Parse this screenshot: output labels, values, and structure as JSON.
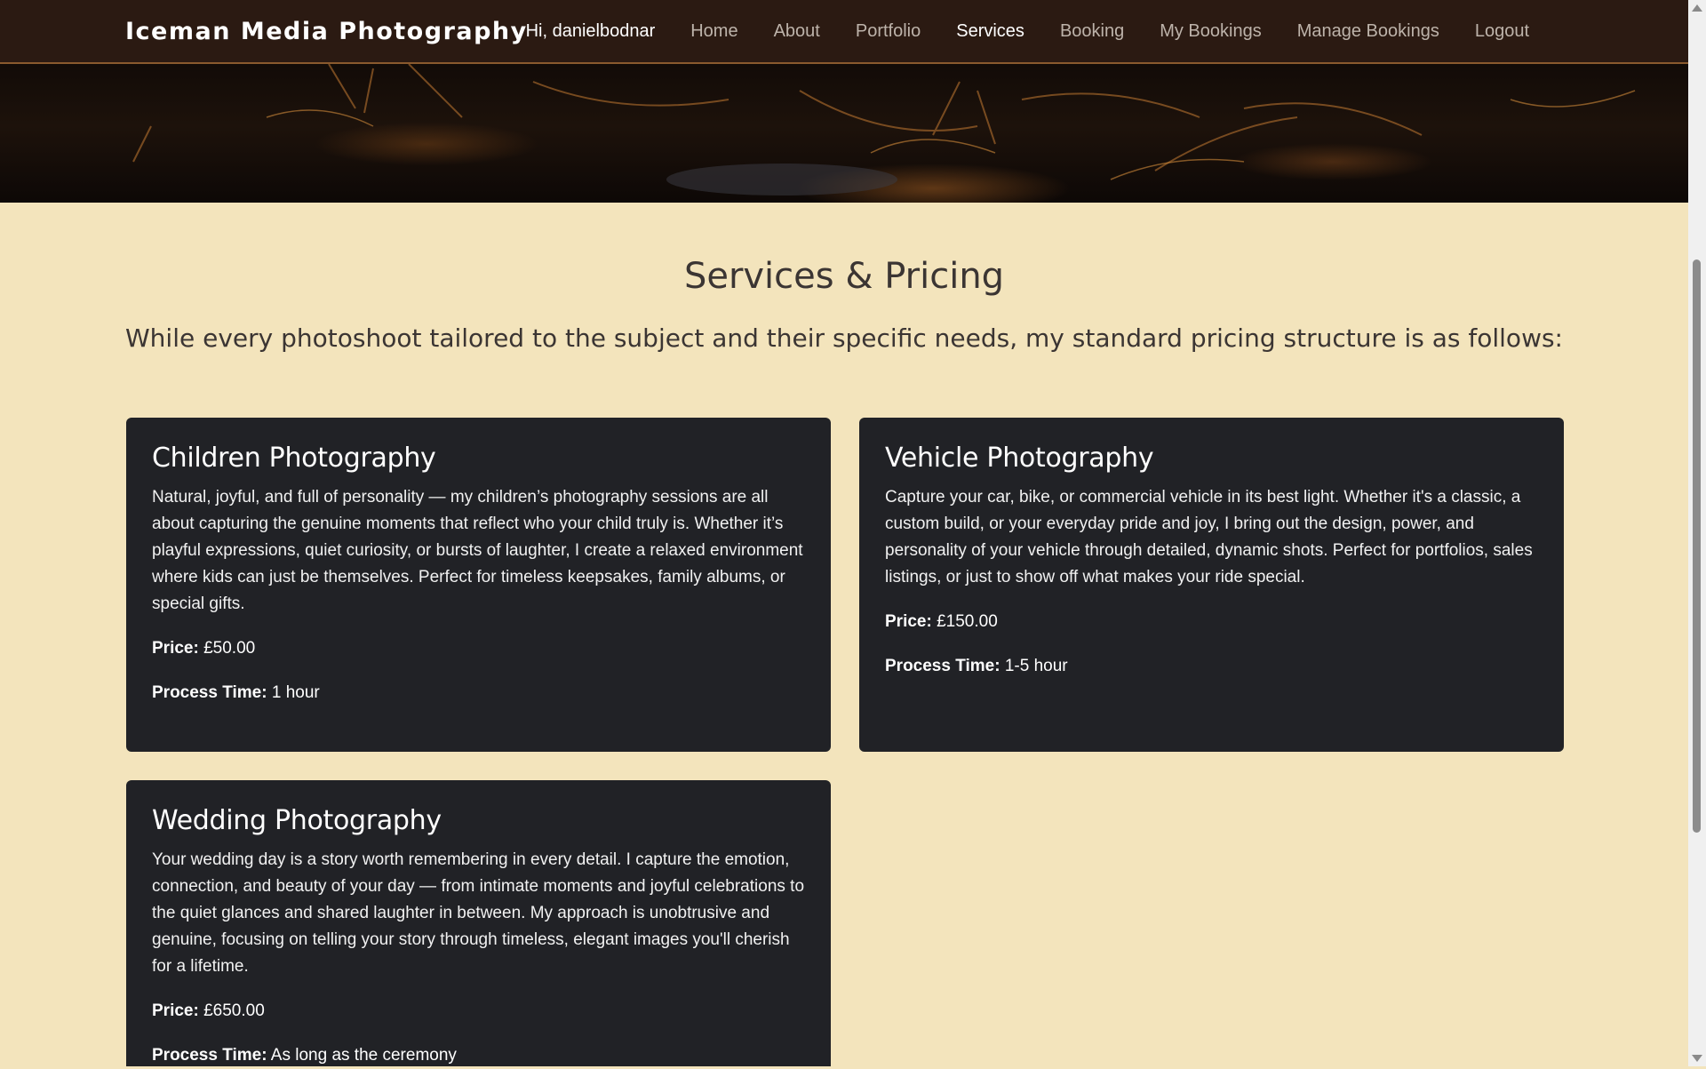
{
  "nav": {
    "brand": "Iceman Media Photography",
    "greeting": "Hi, danielbodnar",
    "links": [
      "Home",
      "About",
      "Portfolio",
      "Services",
      "Booking",
      "My Bookings",
      "Manage Bookings",
      "Logout"
    ],
    "active": "Services"
  },
  "hero": {
    "image": "dark grass at sunset banner"
  },
  "page": {
    "title": "Services & Pricing",
    "subtitle": "While every photoshoot tailored to the subject and their specific needs, my standard pricing structure is as follows:"
  },
  "labels": {
    "price": "Price:",
    "process_time": "Process Time:"
  },
  "services": [
    {
      "title": "Children Photography",
      "description": "Natural, joyful, and full of personality — my children’s photography sessions are all about capturing the genuine moments that reflect who your child truly is. Whether it’s playful expressions, quiet curiosity, or bursts of laughter, I create a relaxed environment where kids can just be themselves. Perfect for timeless keepsakes, family albums, or special gifts.",
      "price": "£50.00",
      "process_time": "1 hour"
    },
    {
      "title": "Vehicle Photography",
      "description": "Capture your car, bike, or commercial vehicle in its best light. Whether it's a classic, a custom build, or your everyday pride and joy, I bring out the design, power, and personality of your vehicle through detailed, dynamic shots. Perfect for portfolios, sales listings, or just to show off what makes your ride special.",
      "price": "£150.00",
      "process_time": "1-5 hour"
    },
    {
      "title": "Wedding Photography",
      "description": "Your wedding day is a story worth remembering in every detail. I capture the emotion, connection, and beauty of your day — from intimate moments and joyful celebrations to the quiet glances and shared laughter in between. My approach is unobtrusive and genuine, focusing on telling your story through timeless, elegant images you'll cherish for a lifetime.",
      "price": "£650.00",
      "process_time": "As long as the ceremony"
    }
  ],
  "colors": {
    "nav_bg": "#2b1a12",
    "page_bg": "#f3e4bc",
    "card_bg": "#212226",
    "heading_text": "#3b3533"
  }
}
